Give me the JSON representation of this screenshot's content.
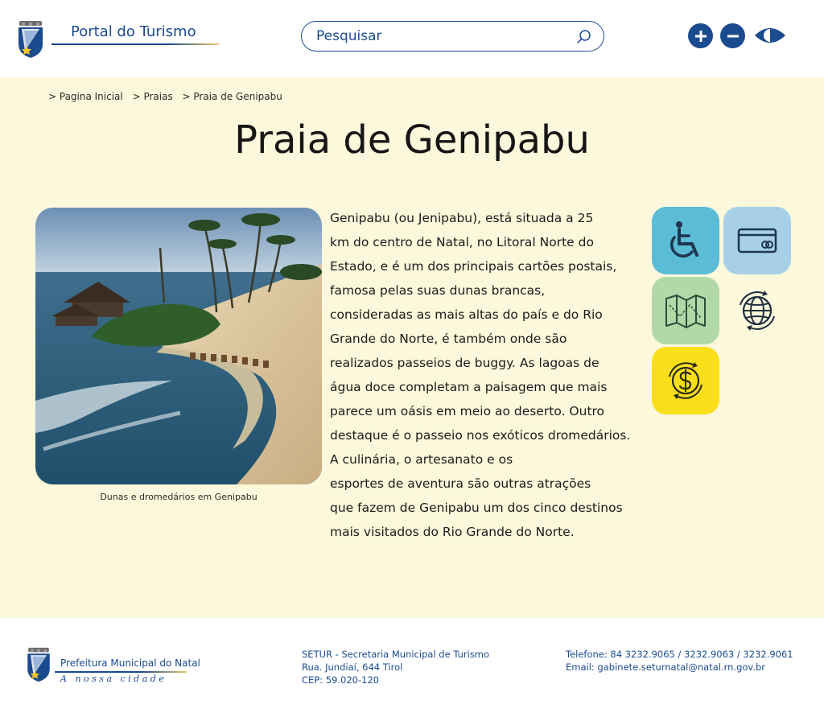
{
  "header": {
    "logo_title": "Portal do Turismo",
    "search_placeholder": "Pesquisar",
    "icons": [
      "search-icon",
      "zoom-in-icon",
      "zoom-out-icon",
      "contrast-eye-icon"
    ],
    "accent_color": "#1b4b8f"
  },
  "breadcrumb": [
    "> Pagina Inicial",
    "> Praias",
    "> Praia de Genipabu"
  ],
  "page_title": "Praia de Genipabu",
  "photo": {
    "caption": "Dunas e dromedários em Genipabu"
  },
  "description": [
    "Genipabu (ou Jenipabu), está situada a 25",
    "km do centro de Natal, no Litoral Norte do",
    "Estado, e é um dos principais cartões postais,",
    "famosa pelas suas dunas brancas,",
    "consideradas as mais altas do país e do Rio",
    "Grande do Norte, é também onde são",
    "realizados passeios de buggy. As lagoas de",
    "água doce completam a paisagem que mais",
    "parece um oásis em meio ao deserto. Outro",
    "destaque é o passeio nos exóticos dromedários.",
    "A culinária, o artesanato e os",
    "esportes de aventura são outras atrações",
    "que fazem de Genipabu um dos cinco destinos",
    "mais visitados do Rio Grande do Norte."
  ],
  "info_tiles": [
    {
      "icon": "wheelchair-icon",
      "color": "#5bbcd6"
    },
    {
      "icon": "credit-card-icon",
      "color": "#a7d0e8"
    },
    {
      "icon": "map-icon",
      "color": "#b1d9a8"
    },
    {
      "icon": "globe-icon",
      "color": "#fbf8db"
    },
    {
      "icon": "currency-exchange-icon",
      "color": "#fbdf1b"
    }
  ],
  "footer": {
    "org_name": "Prefeitura Municipal do Natal",
    "motto": "A nossa cidade",
    "setur_line1": "SETUR - Secretaria Municipal de Turismo",
    "setur_line2": "Rua. Jundiaí, 644 Tirol",
    "setur_line3": "CEP: 59.020-120",
    "phone": "Telefone: 84 3232.9065 / 3232.9063 / 3232.9061",
    "email": "Email: gabinete.seturnatal@natal.rn.gov.br"
  },
  "colors": {
    "main_bg": "#fbf8db",
    "brand_blue": "#1b4b8f"
  }
}
